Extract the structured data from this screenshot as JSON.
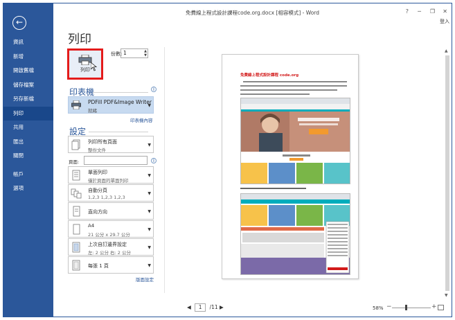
{
  "window": {
    "title": "免費線上程式設計課程code.org.docx [相容模式] - Word",
    "login": "登入"
  },
  "window_controls": {
    "help": "?",
    "minimize": "─",
    "restore": "❐",
    "close": "✕"
  },
  "sidebar": {
    "back_icon": "←",
    "items": [
      {
        "label": "資訊"
      },
      {
        "label": "新增"
      },
      {
        "label": "開啟舊檔"
      },
      {
        "label": "儲存檔案"
      },
      {
        "label": "另存新檔"
      },
      {
        "label": "列印"
      },
      {
        "label": "共用"
      },
      {
        "label": "匯出"
      },
      {
        "label": "關閉"
      },
      {
        "label": "帳戶"
      },
      {
        "label": "選項"
      }
    ],
    "active_index": 5
  },
  "print": {
    "heading": "列印",
    "print_button_label": "列印",
    "copies_label": "份數:",
    "copies_value": "1",
    "printer_section": "印表機",
    "printer_name": "PDFill PDF&Image Writer",
    "printer_status": "就緒",
    "printer_properties_link": "印表機內容",
    "settings_section": "設定",
    "settings": [
      {
        "line1": "列印所有頁面",
        "line2": "整份文件"
      },
      {
        "line1": "單面列印",
        "line2": "僅於頁面的單面列印"
      },
      {
        "line1": "自動分頁",
        "line2": "1,2,3    1,2,3    1,2,3"
      },
      {
        "line1": "直向方向",
        "line2": ""
      },
      {
        "line1": "A4",
        "line2": "21 公分 x 29.7 公分"
      },
      {
        "line1": "上次自訂邊界設定",
        "line2": "左: 2 公分    右: 2 公分"
      },
      {
        "line1": "每張 1 頁",
        "line2": ""
      }
    ],
    "pages_label": "頁面:",
    "pages_value": "",
    "page_setup_link": "版面設定"
  },
  "preview": {
    "doc_title": "免費線上程式設計課程 code.org",
    "step2_text": "2.移至網頁底端，將語言改為「繁體中文」。"
  },
  "pager": {
    "current": "1",
    "total": "/11",
    "prev": "◀",
    "next": "▶"
  },
  "zoom": {
    "percent": "58%",
    "minus": "−",
    "plus": "+"
  }
}
